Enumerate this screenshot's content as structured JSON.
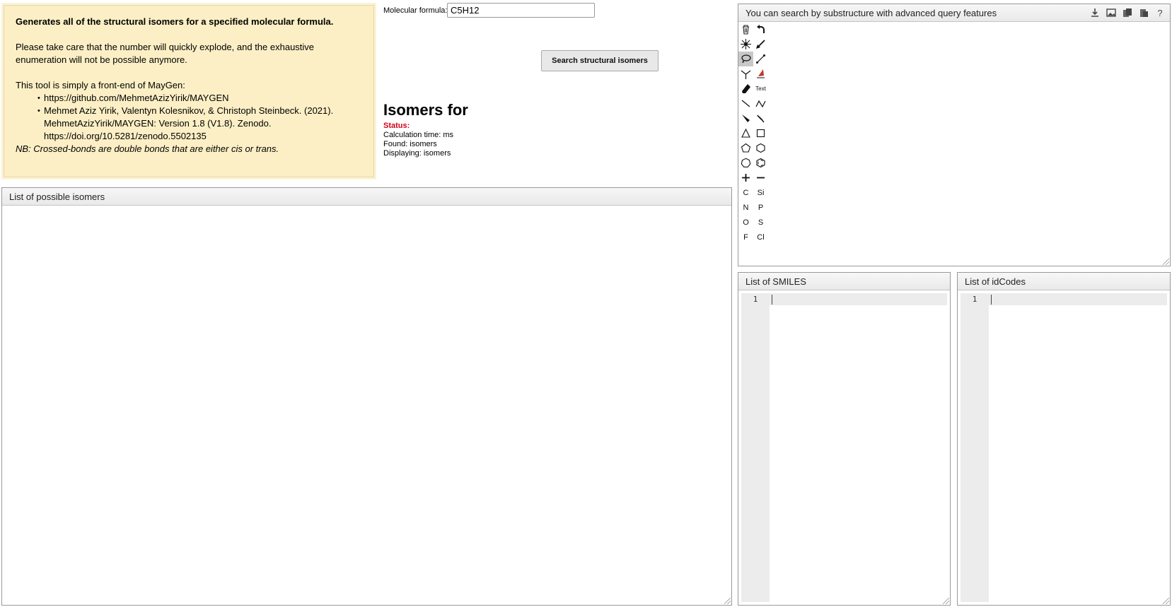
{
  "info": {
    "intro": "Generates all of the structural isomers for a specified molecular formula.",
    "warning": "Please take care that the number will quickly explode, and the exhaustive enumeration will not be possible anymore.",
    "frontend": "This tool is simply a front-end of MayGen:",
    "refs": [
      "https://github.com/MehmetAzizYirik/MAYGEN",
      "Mehmet Aziz Yirik, Valentyn Kolesnikov, & Christoph Steinbeck. (2021). MehmetAzizYirik/MAYGEN: Version 1.8 (V1.8). Zenodo. https://doi.org/10.5281/zenodo.5502135"
    ],
    "nb": "NB: Crossed-bonds are double bonds that are either cis or trans."
  },
  "form": {
    "formula_label": "Molecular formula:",
    "formula_value": "C5H12",
    "search_label": "Search structural isomers"
  },
  "results": {
    "title": "Isomers for",
    "status_label": "Status:",
    "calc_time": "Calculation time: ms",
    "found": "Found: isomers",
    "displaying": "Displaying: isomers"
  },
  "panels": {
    "isomer_list": "List of possible isomers",
    "editor": "You can search by substructure with advanced query features",
    "smiles": "List of SMILES",
    "idcodes": "List of idCodes"
  },
  "editor_actions": [
    "download-icon",
    "image-icon",
    "copy-icon",
    "paste-icon",
    "help-icon"
  ],
  "toolbar_text": {
    "text_tool": "Text",
    "carbon": "C",
    "silicon": "Si",
    "nitrogen": "N",
    "phosphorus": "P",
    "oxygen": "O",
    "sulfur": "S",
    "fluorine": "F",
    "chlorine": "Cl"
  },
  "code": {
    "line1": "1",
    "help": "?"
  }
}
